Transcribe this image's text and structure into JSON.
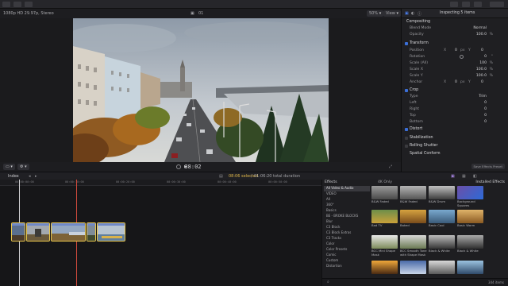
{
  "viewer": {
    "library_label": "1080p HD 29.97p, Stereo",
    "clip_label": "01",
    "zoom": "50%",
    "view_label": "View",
    "timecode": "38:02"
  },
  "inspector": {
    "header": "Inspecting 5 items",
    "compositing_title": "Compositing",
    "blend_mode_label": "Blend Mode",
    "blend_mode_value": "Normal",
    "opacity_label": "Opacity",
    "opacity_value": "100.0",
    "opacity_unit": "%",
    "transform_title": "Transform",
    "position_label": "Position",
    "position_x_axis": "X",
    "position_x": "0",
    "position_x_unit": "px",
    "position_y_axis": "Y",
    "position_y": "0",
    "rotation_label": "Rotation",
    "rotation_value": "0",
    "rotation_unit": "°",
    "scale_all_label": "Scale (All)",
    "scale_all_value": "100",
    "scale_x_label": "Scale X",
    "scale_x_value": "100.0",
    "scale_y_label": "Scale Y",
    "scale_y_value": "100.0",
    "anchor_label": "Anchor",
    "anchor_x_axis": "X",
    "anchor_x": "0",
    "anchor_unit": "px",
    "anchor_y_axis": "Y",
    "anchor_y": "0",
    "crop_title": "Crop",
    "crop_type_label": "Type",
    "crop_type_value": "Trim",
    "left_label": "Left",
    "left_value": "0",
    "right_label": "Right",
    "right_value": "0",
    "top_label": "Top",
    "top_value": "0",
    "bottom_label": "Bottom",
    "bottom_value": "0",
    "distort_title": "Distort",
    "stabilization_title": "Stabilization",
    "rolling_shutter_title": "Rolling Shutter",
    "spatial_conform_title": "Spatial Conform",
    "save_button": "Save Effects Preset"
  },
  "timeline": {
    "index_label": "Index",
    "selection_info": "08:06 selected",
    "duration_info": "01:06:20 total duration",
    "ruler_ticks": [
      "00:00:00:00",
      "00:00:10:00",
      "00:00:20:00",
      "00:00:30:00",
      "00:00:40:00",
      "00:00:50:00",
      "00:01:00:00"
    ]
  },
  "effects": {
    "title": "Effects",
    "filter_label": "4K Only",
    "installed_label": "Installed Effects",
    "categories": [
      "All Video & Audio",
      "VIDEO",
      "All",
      "360°",
      "Basics",
      "BE - BROKE BLOCKS",
      "Blur",
      "C3 Block",
      "C3 Block Extras",
      "C3 Tracks",
      "Color",
      "Color Presets",
      "Comic",
      "Custom",
      "Distortion"
    ],
    "items": [
      "B&W Faded",
      "B&W Faded",
      "B&W Drum",
      "Background Squares",
      "Bad TV",
      "Baked",
      "Basic Cool",
      "Basic Warm",
      "BCC Mini Shape Mask",
      "BCC Smooth Tone with Shape Mask",
      "Black & White",
      "Black & White",
      "",
      "",
      "",
      ""
    ],
    "count_label": "344 items"
  },
  "colors": {
    "accent": "#3b6fd8",
    "clip_border": "#e8c64b",
    "playhead": "#d04a3c"
  }
}
